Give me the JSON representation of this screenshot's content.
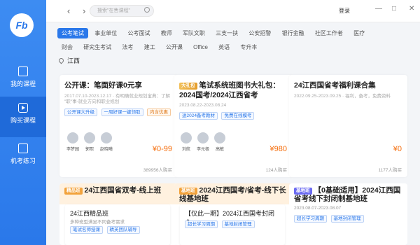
{
  "app": {
    "logo_text": "Fb"
  },
  "sidebar": {
    "items": [
      {
        "label": "我的课程",
        "icon": "book-icon"
      },
      {
        "label": "购买课程",
        "icon": "play-icon"
      },
      {
        "label": "机考练习",
        "icon": "computer-icon"
      }
    ]
  },
  "topbar": {
    "search_placeholder": "搜索\"在售课程\"",
    "login": "登录"
  },
  "categories": {
    "row1": [
      "公考笔试",
      "事业单位",
      "公考面试",
      "教师",
      "军队文职",
      "三支一扶",
      "公安招警",
      "银行金融",
      "社区工作者",
      "医疗"
    ],
    "row2": [
      "财会",
      "研究生考试",
      "法考",
      "建工",
      "公开课",
      "Office",
      "英语",
      "专升本"
    ],
    "active": "公考笔试"
  },
  "location": "江西",
  "cards": [
    {
      "title": "公开课：笔面好课0元享",
      "sub1": "2017.07.10-2023.12.17 · 有明确就业规划宝典：了解",
      "sub2": "\"职\"事-就业方向和职业规划",
      "tags": [
        "公开课大升级",
        "一周好课一键领取",
        "内含优惠"
      ],
      "teachers": [
        "李梦园",
        "郭熙",
        "赵晓曦"
      ],
      "price": "¥0-99",
      "count": "389956人购买"
    },
    {
      "badge": "大礼包",
      "title": "笔试系统班图书大礼包：2024国考/2024江西省考",
      "sub1": "2023.08.22-2023.08.24",
      "tags": [
        "送2024备考教材",
        "免费在线模考"
      ],
      "teachers": [
        "刘航",
        "李元极",
        "高敏"
      ],
      "price": "¥980",
      "count": "124人购买"
    },
    {
      "title": "24江西国省考福利课合集",
      "sub1": "2022.09.25-2023.09.25 · 福利，备考，免费资料",
      "price": "¥0",
      "count": "1177人购买"
    }
  ],
  "bottom_cards": [
    {
      "badge": "精品班",
      "title": "24江西国省双考-线上班",
      "inner_title": "24江西精品班",
      "inner_sub": "多种班型满足不同备考需求",
      "tags": [
        "笔试名师授课",
        "精英团队辅导"
      ]
    },
    {
      "badge": "基地班",
      "title": "2024江西国考/省考-线下长线基地班",
      "inner_title": "【仅此一期】2024江西国考封闭全...",
      "tags": [
        "超长学习周期",
        "基地封闭管理"
      ]
    },
    {
      "badge": "基地班",
      "title": "【0基础适用】2024江西国省考线下封闭制基地班",
      "date": "2023.08.07-2023.08.07",
      "tags": [
        "超长学习周期",
        "基地封闭管理"
      ]
    }
  ]
}
